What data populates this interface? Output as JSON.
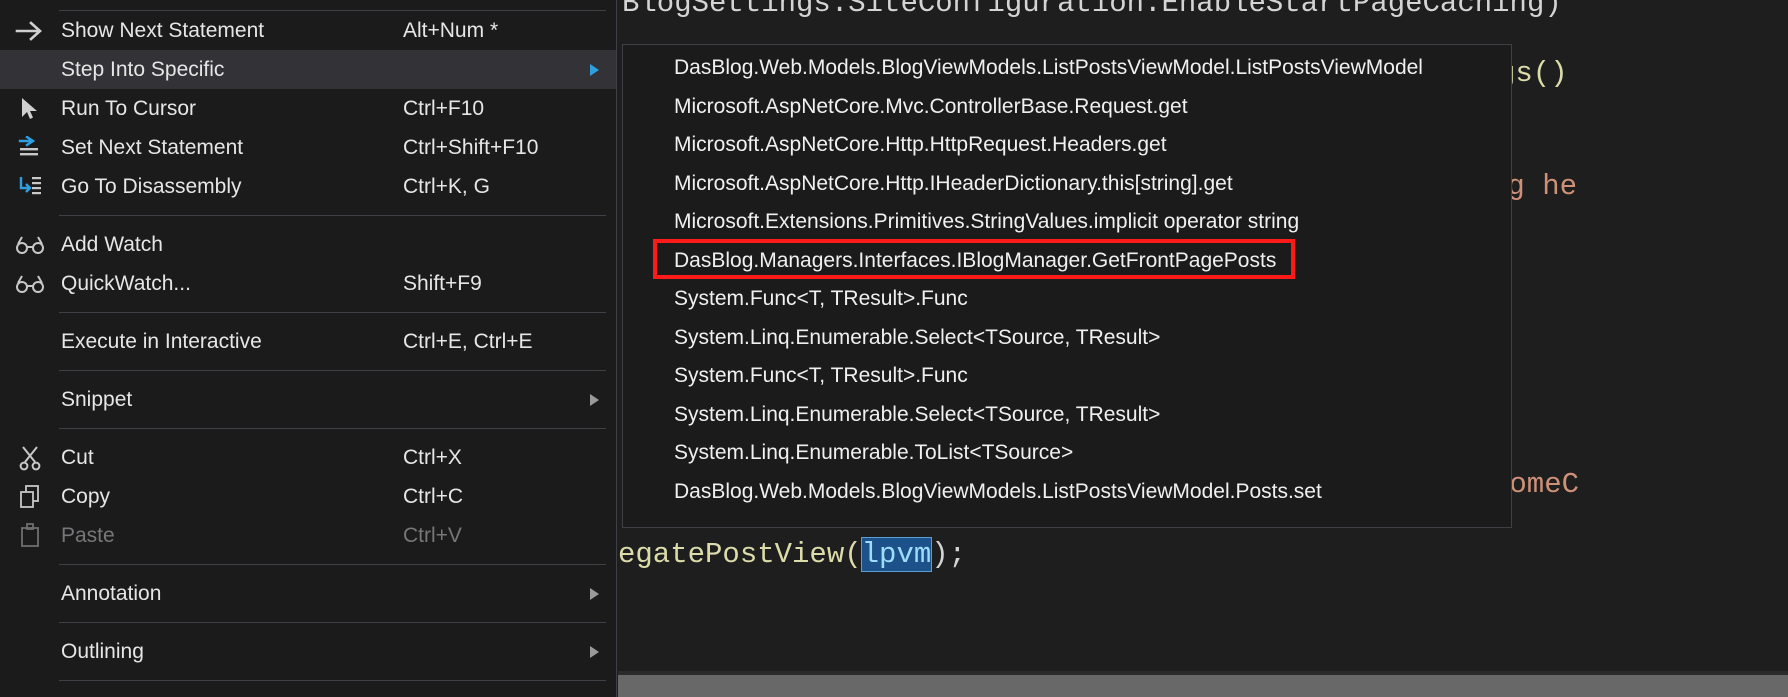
{
  "editor": {
    "code_top": "BlogSettings.SiteConfiguration.EnableStartPageCaching)",
    "code_right_1": "gs()",
    "code_right_2": "og he",
    "code_right_3": "lomeC",
    "code_bottom_prefix": "egatePostView(",
    "code_bottom_selection": "lpvm",
    "code_bottom_suffix": ");"
  },
  "context_menu": {
    "items": [
      {
        "label": "Show Next Statement",
        "shortcut": "Alt+Num *",
        "icon": "arrow-right-icon",
        "submenu": false,
        "highlight": false,
        "disabled": false,
        "separator_after": false
      },
      {
        "label": "Step Into Specific",
        "shortcut": "",
        "icon": "none",
        "submenu": true,
        "highlight": true,
        "disabled": false,
        "separator_after": false
      },
      {
        "label": "Run To Cursor",
        "shortcut": "Ctrl+F10",
        "icon": "cursor-arrow-icon",
        "submenu": false,
        "highlight": false,
        "disabled": false,
        "separator_after": false
      },
      {
        "label": "Set Next Statement",
        "shortcut": "Ctrl+Shift+F10",
        "icon": "set-next-statement-icon",
        "submenu": false,
        "highlight": false,
        "disabled": false,
        "separator_after": false
      },
      {
        "label": "Go To Disassembly",
        "shortcut": "Ctrl+K, G",
        "icon": "disassembly-icon",
        "submenu": false,
        "highlight": false,
        "disabled": false,
        "separator_after": true
      },
      {
        "label": "Add Watch",
        "shortcut": "",
        "icon": "glasses-icon",
        "submenu": false,
        "highlight": false,
        "disabled": false,
        "separator_after": false
      },
      {
        "label": "QuickWatch...",
        "shortcut": "Shift+F9",
        "icon": "glasses-icon",
        "submenu": false,
        "highlight": false,
        "disabled": false,
        "separator_after": true
      },
      {
        "label": "Execute in Interactive",
        "shortcut": "Ctrl+E, Ctrl+E",
        "icon": "none",
        "submenu": false,
        "highlight": false,
        "disabled": false,
        "separator_after": true
      },
      {
        "label": "Snippet",
        "shortcut": "",
        "icon": "none",
        "submenu": true,
        "highlight": false,
        "disabled": false,
        "separator_after": true
      },
      {
        "label": "Cut",
        "shortcut": "Ctrl+X",
        "icon": "scissors-icon",
        "submenu": false,
        "highlight": false,
        "disabled": false,
        "separator_after": false
      },
      {
        "label": "Copy",
        "shortcut": "Ctrl+C",
        "icon": "copy-icon",
        "submenu": false,
        "highlight": false,
        "disabled": false,
        "separator_after": false
      },
      {
        "label": "Paste",
        "shortcut": "Ctrl+V",
        "icon": "clipboard-icon",
        "submenu": false,
        "highlight": false,
        "disabled": true,
        "separator_after": true
      },
      {
        "label": "Annotation",
        "shortcut": "",
        "icon": "none",
        "submenu": true,
        "highlight": false,
        "disabled": false,
        "separator_after": true
      },
      {
        "label": "Outlining",
        "shortcut": "",
        "icon": "none",
        "submenu": true,
        "highlight": false,
        "disabled": false,
        "separator_after": true
      }
    ]
  },
  "submenu": {
    "title": "Step Into Specific",
    "highlight_color": "#ff1a1a",
    "items": [
      {
        "label": "DasBlog.Web.Models.BlogViewModels.ListPostsViewModel.ListPostsViewModel",
        "boxed": false
      },
      {
        "label": "Microsoft.AspNetCore.Mvc.ControllerBase.Request.get",
        "boxed": false
      },
      {
        "label": "Microsoft.AspNetCore.Http.HttpRequest.Headers.get",
        "boxed": false
      },
      {
        "label": "Microsoft.AspNetCore.Http.IHeaderDictionary.this[string].get",
        "boxed": false
      },
      {
        "label": "Microsoft.Extensions.Primitives.StringValues.implicit operator string",
        "boxed": false
      },
      {
        "label": "DasBlog.Managers.Interfaces.IBlogManager.GetFrontPagePosts",
        "boxed": true
      },
      {
        "label": "System.Func<T, TResult>.Func",
        "boxed": false
      },
      {
        "label": "System.Linq.Enumerable.Select<TSource, TResult>",
        "boxed": false
      },
      {
        "label": "System.Func<T, TResult>.Func",
        "boxed": false
      },
      {
        "label": "System.Linq.Enumerable.Select<TSource, TResult>",
        "boxed": false
      },
      {
        "label": "System.Linq.Enumerable.ToList<TSource>",
        "boxed": false
      },
      {
        "label": "DasBlog.Web.Models.BlogViewModels.ListPostsViewModel.Posts.set",
        "boxed": false
      }
    ]
  }
}
